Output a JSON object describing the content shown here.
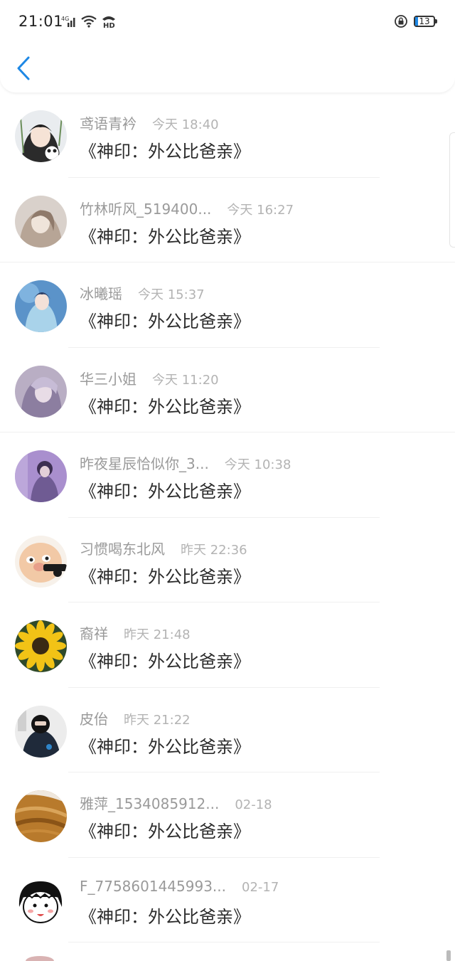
{
  "status_bar": {
    "time": "21:01",
    "network": "4G",
    "hd_label": "HD",
    "battery": "13"
  },
  "nav": {
    "back_icon": "chevron-left-icon"
  },
  "colors": {
    "accent": "#1e88e5",
    "name": "#9a9a9a",
    "time": "#b3b3b3",
    "message": "#2b2b2b"
  },
  "items": [
    {
      "name": "鸢语青衿",
      "time": "今天 18:40",
      "message": "《神印：外公比爸亲》"
    },
    {
      "name": "竹林听风_519400...",
      "time": "今天 16:27",
      "message": "《神印：外公比爸亲》"
    },
    {
      "name": "冰曦瑶",
      "time": "今天 15:37",
      "message": "《神印：外公比爸亲》"
    },
    {
      "name": "华三小姐",
      "time": "今天 11:20",
      "message": "《神印：外公比爸亲》"
    },
    {
      "name": "昨夜星辰恰似你_3...",
      "time": "今天 10:38",
      "message": "《神印：外公比爸亲》"
    },
    {
      "name": "习惯喝东北风",
      "time": "昨天 22:36",
      "message": "《神印：外公比爸亲》"
    },
    {
      "name": "裔祥",
      "time": "昨天 21:48",
      "message": "《神印：外公比爸亲》"
    },
    {
      "name": "皮佁",
      "time": "昨天 21:22",
      "message": "《神印：外公比爸亲》"
    },
    {
      "name": "雅萍_1534085912...",
      "time": "02-18",
      "message": "《神印：外公比爸亲》"
    },
    {
      "name": "F_7758601445993...",
      "time": "02-17",
      "message": "《神印：外公比爸亲》"
    }
  ]
}
